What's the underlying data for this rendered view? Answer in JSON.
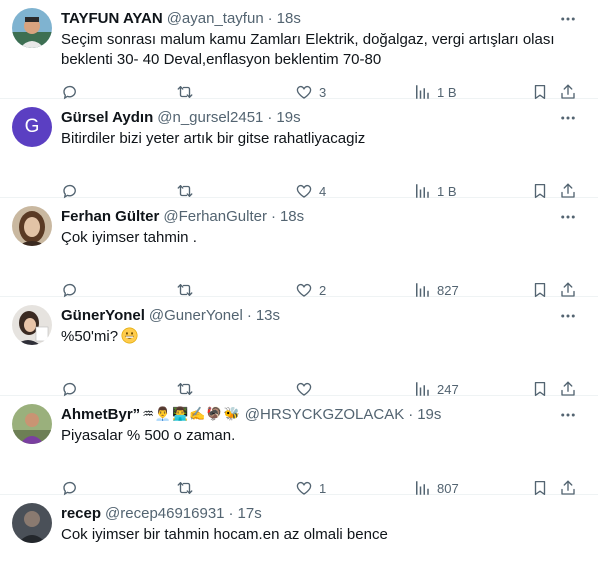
{
  "tweets": [
    {
      "name": "TAYFUN AYAN",
      "name_emoji": "",
      "handle": "@ayan_tayfun",
      "separator": "·",
      "time": "18s",
      "text": "Seçim sonrası malum kamu Zamları Elektrik,  doğalgaz, vergi artışları olası beklenti 30- 40 Deval,enflasyon beklentim 70-80",
      "replies": "",
      "retweets": "",
      "likes": "3",
      "views": "1 B",
      "avatar": "photo"
    },
    {
      "name": "Gürsel Aydın",
      "name_emoji": "",
      "handle": "@n_gursel2451",
      "separator": "·",
      "time": "19s",
      "text": "Bitirdiler bizi yeter artık bir gitse rahatliyacagiz",
      "replies": "",
      "retweets": "",
      "likes": "4",
      "views": "1 B",
      "avatar": "letter",
      "avatar_letter": "G"
    },
    {
      "name": "Ferhan Gülter",
      "name_emoji": "",
      "handle": "@FerhanGulter",
      "separator": "·",
      "time": "18s",
      "text": "Çok iyimser tahmin .",
      "replies": "",
      "retweets": "",
      "likes": "2",
      "views": "827",
      "avatar": "photo"
    },
    {
      "name": "GünerYonel",
      "name_emoji": "",
      "handle": "@GunerYonel",
      "separator": "·",
      "time": "13s",
      "text": "%50'mi?",
      "text_emoji": "grinning-face",
      "replies": "",
      "retweets": "",
      "likes": "",
      "views": "247",
      "avatar": "photo"
    },
    {
      "name": "AhmetByr”",
      "name_emoji": "♒👨‍💼👨‍💻✍️🦃🐝",
      "handle": "@HRSYCKGZOLACAK",
      "separator": "·",
      "time": "19s",
      "text": "Piyasalar % 500 o zaman.",
      "replies": "",
      "retweets": "",
      "likes": "1",
      "views": "807",
      "avatar": "photo"
    },
    {
      "name": "recep",
      "name_emoji": "",
      "handle": "@recep46916931",
      "separator": "·",
      "time": "17s",
      "text": "Cok iyimser bir tahmin hocam.en az olmali bence",
      "avatar": "photo"
    }
  ],
  "colors": {
    "text_primary": "#0f1419",
    "text_secondary": "#536471",
    "divider": "#eff3f4",
    "avatar_letter_bg": "#5b3fc2"
  },
  "icons": [
    "more-icon",
    "reply-icon",
    "retweet-icon",
    "like-icon",
    "views-icon",
    "bookmark-icon",
    "share-icon"
  ]
}
